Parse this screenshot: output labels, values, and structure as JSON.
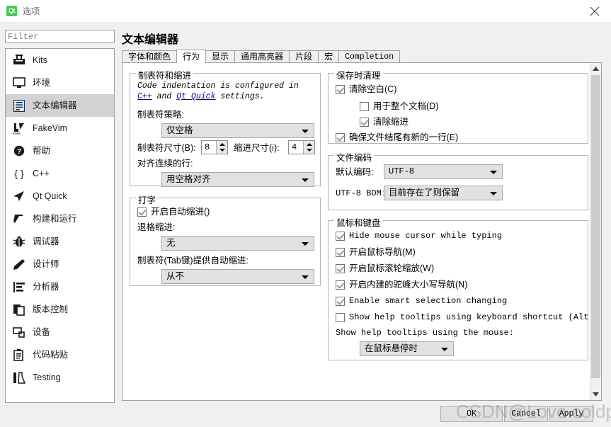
{
  "window": {
    "title": "选项",
    "logo_text": "Qt",
    "close_icon": "close-icon"
  },
  "search": {
    "placeholder": "Filter",
    "value": ""
  },
  "sidebar": {
    "items": [
      {
        "label": "Kits",
        "icon": "kits-icon",
        "selected": false
      },
      {
        "label": "环境",
        "icon": "monitor-icon",
        "selected": false
      },
      {
        "label": "文本编辑器",
        "icon": "text-editor-icon",
        "selected": true
      },
      {
        "label": "FakeVim",
        "icon": "fakevim-icon",
        "selected": false
      },
      {
        "label": "帮助",
        "icon": "help-icon",
        "selected": false
      },
      {
        "label": "C++",
        "icon": "braces-icon",
        "selected": false
      },
      {
        "label": "Qt Quick",
        "icon": "qtquick-icon",
        "selected": false
      },
      {
        "label": "构建和运行",
        "icon": "hammer-icon",
        "selected": false
      },
      {
        "label": "调试器",
        "icon": "bug-icon",
        "selected": false
      },
      {
        "label": "设计师",
        "icon": "pencil-icon",
        "selected": false
      },
      {
        "label": "分析器",
        "icon": "analyzer-icon",
        "selected": false
      },
      {
        "label": "版本控制",
        "icon": "version-control-icon",
        "selected": false
      },
      {
        "label": "设备",
        "icon": "devices-icon",
        "selected": false
      },
      {
        "label": "代码粘贴",
        "icon": "clipboard-icon",
        "selected": false
      },
      {
        "label": "Testing",
        "icon": "flask-icon",
        "selected": false
      }
    ]
  },
  "page": {
    "title": "文本编辑器",
    "tabs": [
      {
        "label": "字体和颜色",
        "active": false,
        "mono": false
      },
      {
        "label": "行为",
        "active": true,
        "mono": false
      },
      {
        "label": "显示",
        "active": false,
        "mono": false
      },
      {
        "label": "通用高亮器",
        "active": false,
        "mono": false
      },
      {
        "label": "片段",
        "active": false,
        "mono": false
      },
      {
        "label": "宏",
        "active": false,
        "mono": false
      },
      {
        "label": "Completion",
        "active": false,
        "mono": true
      }
    ]
  },
  "tabs_indent": {
    "group_title": "制表符和缩进",
    "info_prefix": "Code indentation is configured in ",
    "info_link1": "C++",
    "info_mid": " and ",
    "info_link2": "Qt Quick",
    "info_suffix": " settings.",
    "tab_policy_label": "制表符策略:",
    "tab_policy_value": "仅空格",
    "tab_size_label": "制表符尺寸(B):",
    "tab_size_value": "8",
    "indent_size_label": "缩进尺寸(i):",
    "indent_size_value": "4",
    "align_label": "对齐连续的行:",
    "align_value": "用空格对齐"
  },
  "typing": {
    "group_title": "打字",
    "auto_indent_label": "开启自动缩进()",
    "auto_indent_checked": true,
    "backspace_label": "退格缩进:",
    "backspace_value": "无",
    "tab_key_label": "制表符(Tab键)提供自动缩进:",
    "tab_key_value": "从不"
  },
  "cleanup": {
    "group_title": "保存时清理",
    "clean_ws_label": "清除空白(C)",
    "clean_ws_checked": true,
    "whole_doc_label": "用于整个文档(D)",
    "whole_doc_checked": false,
    "clean_indent_label": "清除缩进",
    "clean_indent_checked": true,
    "ensure_newline_label": "确保文件结尾有新的一行(E)",
    "ensure_newline_checked": true
  },
  "encoding": {
    "group_title": "文件编码",
    "default_label": "默认编码:",
    "default_value": "UTF-8",
    "bom_label": "UTF-8 BOM:",
    "bom_value": "目前存在了则保留"
  },
  "mouse_kb": {
    "group_title": "鼠标和键盘",
    "hide_cursor_label": "Hide mouse cursor while typing",
    "hide_cursor_checked": true,
    "mouse_nav_label": "开启鼠标导航(M)",
    "mouse_nav_checked": true,
    "wheel_zoom_label": "开启鼠标滚轮缩放(W)",
    "wheel_zoom_checked": true,
    "camel_case_label": "开启内建的驼峰大小写导航(N)",
    "camel_case_checked": true,
    "smart_select_label": "Enable smart selection changing",
    "smart_select_checked": true,
    "tooltip_kb_label": "Show help tooltips using keyboard shortcut (Alt)",
    "tooltip_kb_checked": false,
    "tooltip_mouse_label": "Show help tooltips using the mouse:",
    "tooltip_mouse_value": "在鼠标悬停时"
  },
  "buttons": {
    "ok": "OK",
    "cancel": "Cancel",
    "apply": "Apply"
  },
  "watermark": {
    "text": "CSDN@Love coldplay"
  }
}
